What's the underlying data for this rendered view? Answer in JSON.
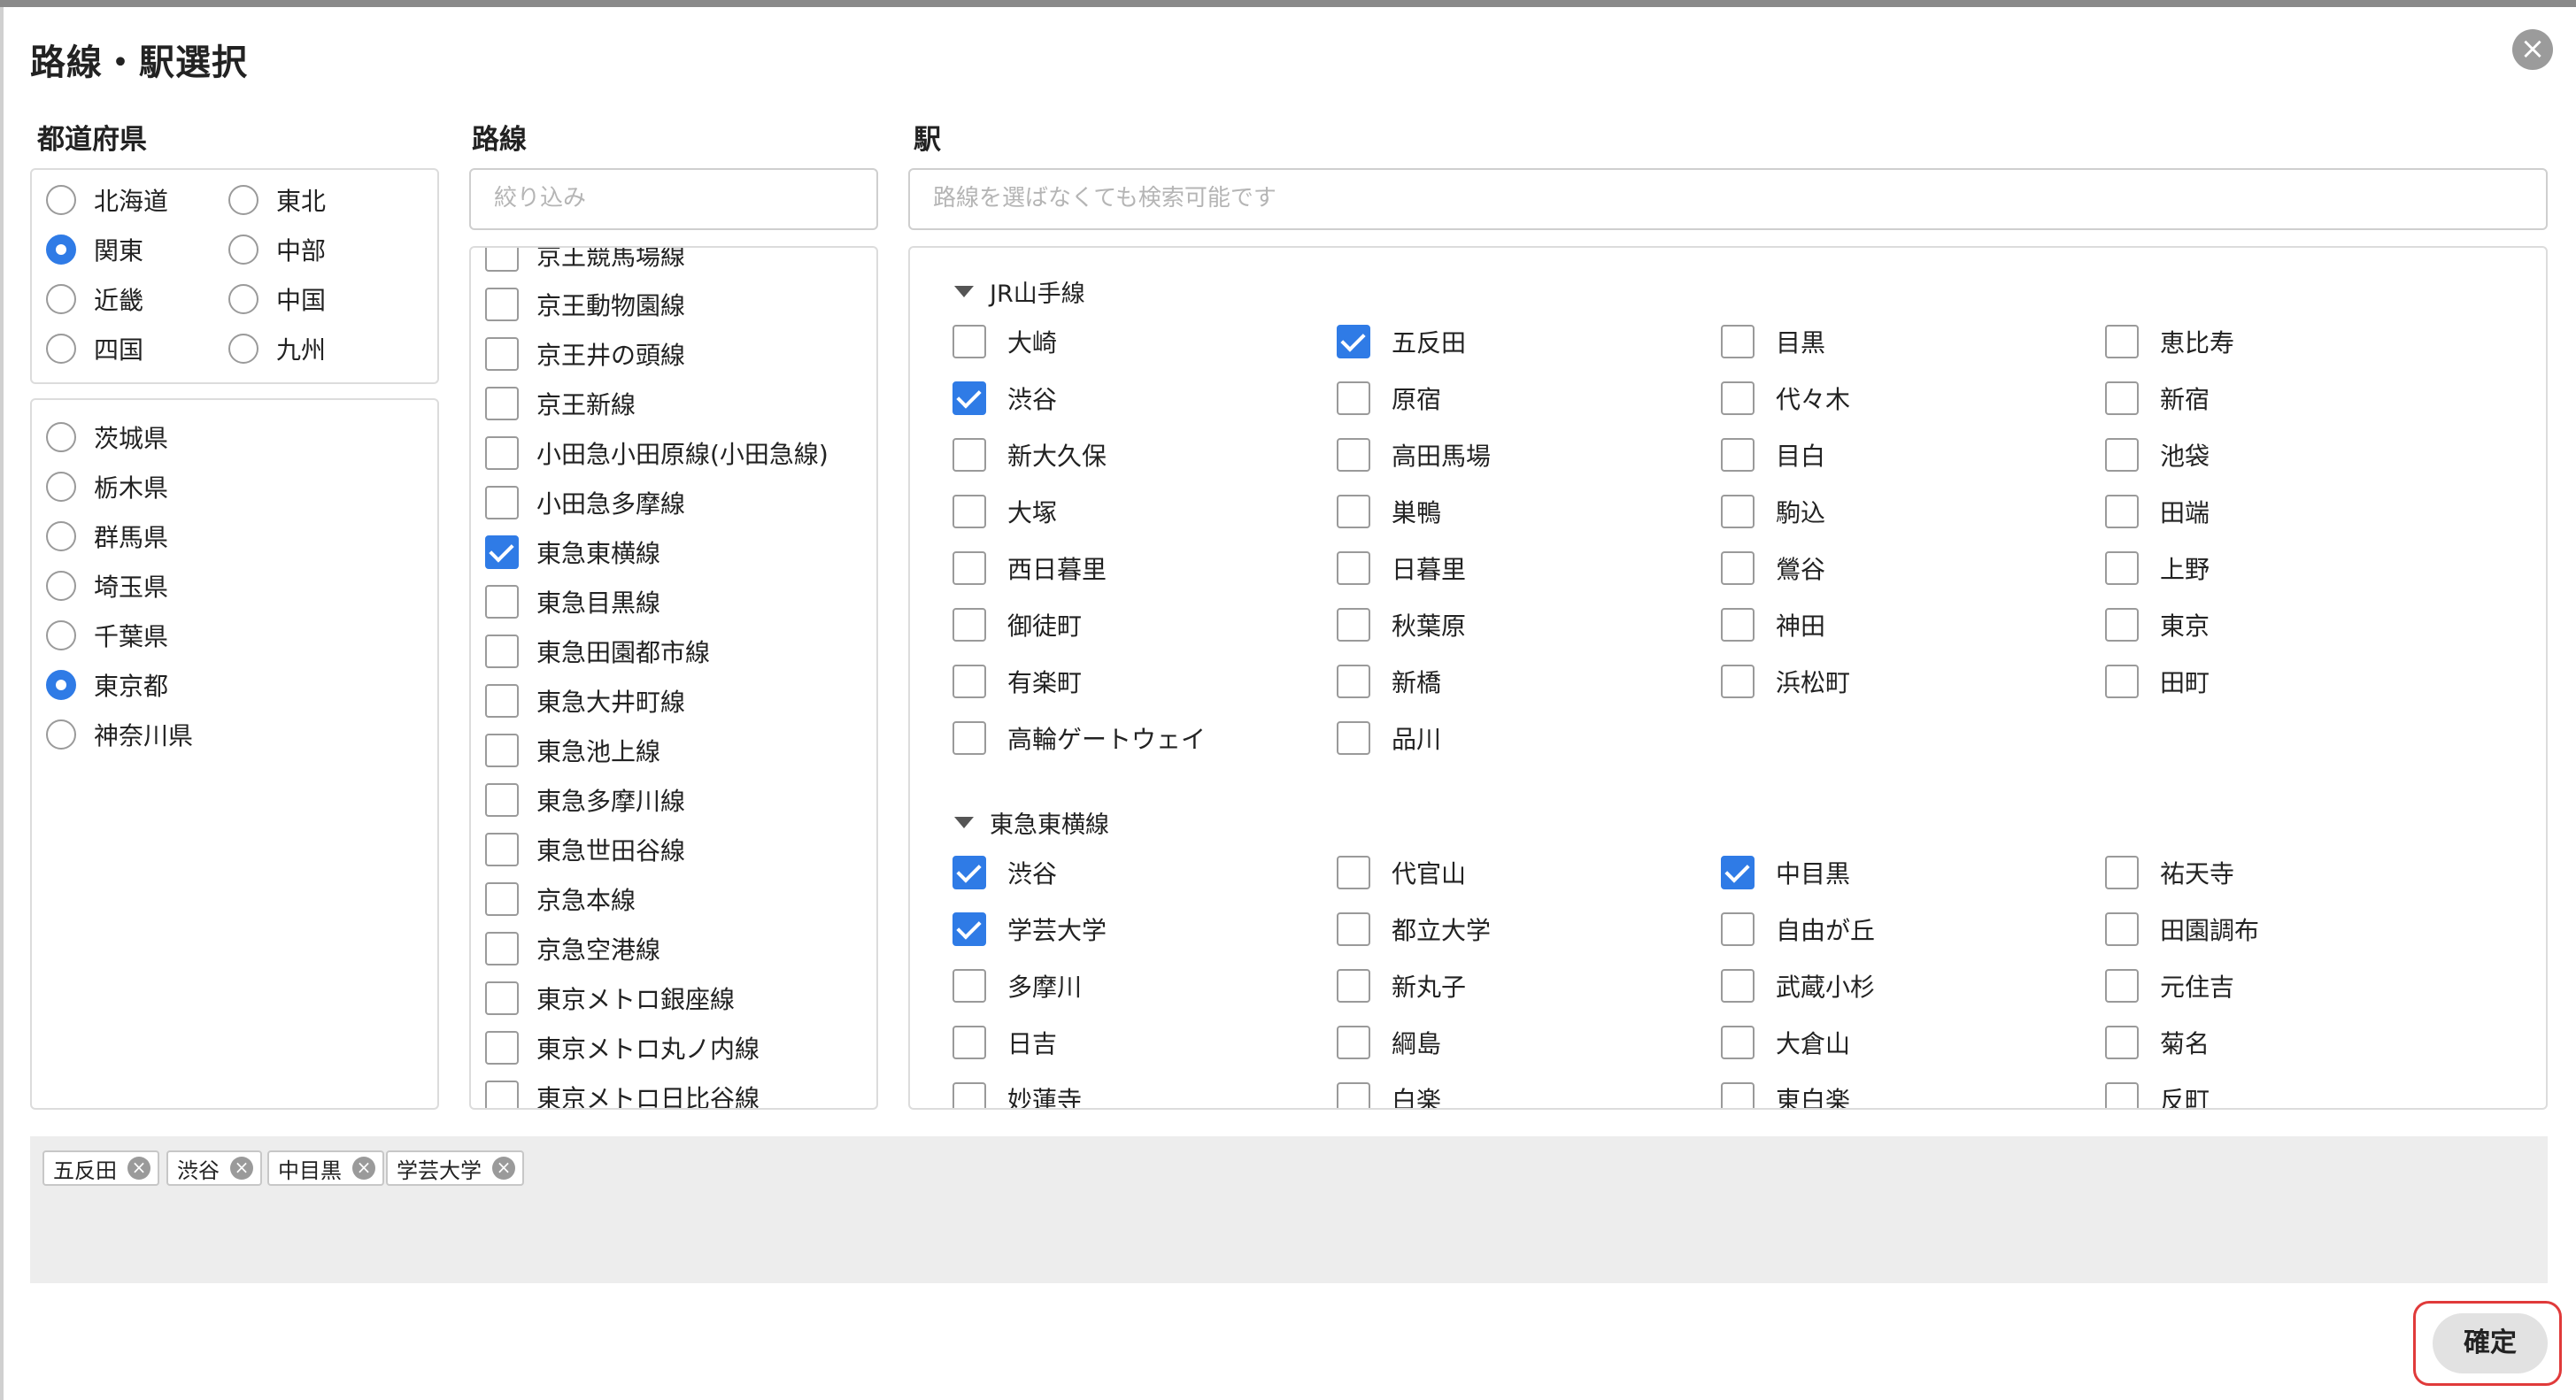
{
  "title": "路線・駅選択",
  "close_glyph": "×",
  "columns": {
    "prefecture": "都道府県",
    "line": "路線",
    "station": "駅"
  },
  "regions": [
    {
      "label": "北海道",
      "selected": false
    },
    {
      "label": "東北",
      "selected": false
    },
    {
      "label": "関東",
      "selected": true
    },
    {
      "label": "中部",
      "selected": false
    },
    {
      "label": "近畿",
      "selected": false
    },
    {
      "label": "中国",
      "selected": false
    },
    {
      "label": "四国",
      "selected": false
    },
    {
      "label": "九州",
      "selected": false
    }
  ],
  "prefectures": [
    {
      "label": "茨城県",
      "selected": false
    },
    {
      "label": "栃木県",
      "selected": false
    },
    {
      "label": "群馬県",
      "selected": false
    },
    {
      "label": "埼玉県",
      "selected": false
    },
    {
      "label": "千葉県",
      "selected": false
    },
    {
      "label": "東京都",
      "selected": true
    },
    {
      "label": "神奈川県",
      "selected": false
    }
  ],
  "line_filter": {
    "placeholder": "絞り込み"
  },
  "lines": [
    {
      "label": "京王競馬場線",
      "checked": false
    },
    {
      "label": "京王動物園線",
      "checked": false
    },
    {
      "label": "京王井の頭線",
      "checked": false
    },
    {
      "label": "京王新線",
      "checked": false
    },
    {
      "label": "小田急小田原線(小田急線)",
      "checked": false
    },
    {
      "label": "小田急多摩線",
      "checked": false
    },
    {
      "label": "東急東横線",
      "checked": true
    },
    {
      "label": "東急目黒線",
      "checked": false
    },
    {
      "label": "東急田園都市線",
      "checked": false
    },
    {
      "label": "東急大井町線",
      "checked": false
    },
    {
      "label": "東急池上線",
      "checked": false
    },
    {
      "label": "東急多摩川線",
      "checked": false
    },
    {
      "label": "東急世田谷線",
      "checked": false
    },
    {
      "label": "京急本線",
      "checked": false
    },
    {
      "label": "京急空港線",
      "checked": false
    },
    {
      "label": "東京メトロ銀座線",
      "checked": false
    },
    {
      "label": "東京メトロ丸ノ内線",
      "checked": false
    },
    {
      "label": "東京メトロ日比谷線",
      "checked": false
    }
  ],
  "station_search": {
    "placeholder": "路線を選ばなくても検索可能です"
  },
  "station_groups": [
    {
      "name": "JR山手線",
      "stations": [
        {
          "label": "大崎",
          "checked": false
        },
        {
          "label": "五反田",
          "checked": true
        },
        {
          "label": "目黒",
          "checked": false
        },
        {
          "label": "恵比寿",
          "checked": false
        },
        {
          "label": "渋谷",
          "checked": true
        },
        {
          "label": "原宿",
          "checked": false
        },
        {
          "label": "代々木",
          "checked": false
        },
        {
          "label": "新宿",
          "checked": false
        },
        {
          "label": "新大久保",
          "checked": false
        },
        {
          "label": "高田馬場",
          "checked": false
        },
        {
          "label": "目白",
          "checked": false
        },
        {
          "label": "池袋",
          "checked": false
        },
        {
          "label": "大塚",
          "checked": false
        },
        {
          "label": "巣鴨",
          "checked": false
        },
        {
          "label": "駒込",
          "checked": false
        },
        {
          "label": "田端",
          "checked": false
        },
        {
          "label": "西日暮里",
          "checked": false
        },
        {
          "label": "日暮里",
          "checked": false
        },
        {
          "label": "鶯谷",
          "checked": false
        },
        {
          "label": "上野",
          "checked": false
        },
        {
          "label": "御徒町",
          "checked": false
        },
        {
          "label": "秋葉原",
          "checked": false
        },
        {
          "label": "神田",
          "checked": false
        },
        {
          "label": "東京",
          "checked": false
        },
        {
          "label": "有楽町",
          "checked": false
        },
        {
          "label": "新橋",
          "checked": false
        },
        {
          "label": "浜松町",
          "checked": false
        },
        {
          "label": "田町",
          "checked": false
        },
        {
          "label": "高輪ゲートウェイ",
          "checked": false
        },
        {
          "label": "品川",
          "checked": false
        }
      ]
    },
    {
      "name": "東急東横線",
      "stations": [
        {
          "label": "渋谷",
          "checked": true
        },
        {
          "label": "代官山",
          "checked": false
        },
        {
          "label": "中目黒",
          "checked": true
        },
        {
          "label": "祐天寺",
          "checked": false
        },
        {
          "label": "学芸大学",
          "checked": true
        },
        {
          "label": "都立大学",
          "checked": false
        },
        {
          "label": "自由が丘",
          "checked": false
        },
        {
          "label": "田園調布",
          "checked": false
        },
        {
          "label": "多摩川",
          "checked": false
        },
        {
          "label": "新丸子",
          "checked": false
        },
        {
          "label": "武蔵小杉",
          "checked": false
        },
        {
          "label": "元住吉",
          "checked": false
        },
        {
          "label": "日吉",
          "checked": false
        },
        {
          "label": "綱島",
          "checked": false
        },
        {
          "label": "大倉山",
          "checked": false
        },
        {
          "label": "菊名",
          "checked": false
        },
        {
          "label": "妙蓮寺",
          "checked": false
        },
        {
          "label": "白楽",
          "checked": false
        },
        {
          "label": "東白楽",
          "checked": false
        },
        {
          "label": "反町",
          "checked": false
        }
      ]
    }
  ],
  "selected_chips": [
    "五反田",
    "渋谷",
    "中目黒",
    "学芸大学"
  ],
  "chip_remove_glyph": "×",
  "confirm_label": "確定",
  "colors": {
    "accent": "#2f7be6",
    "highlight_ring": "#e03a3a"
  }
}
